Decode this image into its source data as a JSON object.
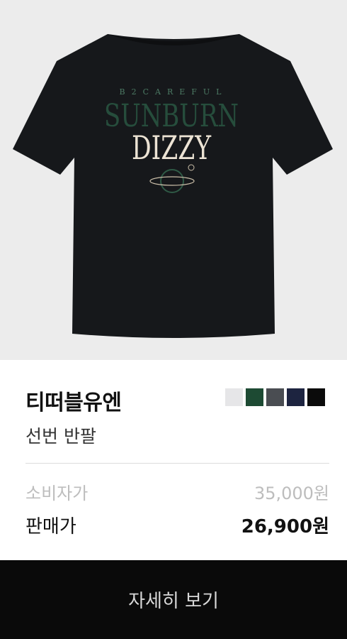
{
  "image": {
    "alt": "티떠블유엔 선번 반팔",
    "print_small": "B2CAREFUL",
    "print_main": "SUNBURN",
    "print_sub": "DIZZY"
  },
  "product": {
    "brand": "티떠블유엔",
    "name": "선번 반팔",
    "swatches": [
      "#e6e6e8",
      "#1d4a33",
      "#4a4d52",
      "#1d2440",
      "#0b0b0b"
    ]
  },
  "price": {
    "msrp_label": "소비자가",
    "msrp_value": "35,000원",
    "sale_label": "판매가",
    "sale_value": "26,900원"
  },
  "cta": {
    "label": "자세히 보기"
  }
}
